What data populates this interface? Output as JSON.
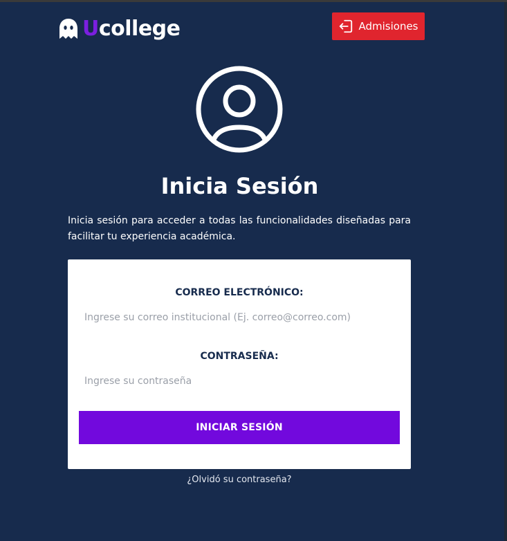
{
  "header": {
    "logo_u": "U",
    "logo_rest": "college",
    "admissions_label": "Admisiones",
    "admissions_icon": "login-arrow-icon"
  },
  "main": {
    "avatar_icon": "user-circle-icon",
    "title": "Inicia Sesión",
    "intro": "Inicia sesión para acceder a todas las funcionalidades diseñadas para facilitar tu experiencia académica."
  },
  "form": {
    "email_label": "CORREO ELECTRÓNICO:",
    "email_value": "",
    "email_placeholder": "Ingrese su correo institucional (Ej. correo@correo.com)",
    "password_label": "CONTRASEÑA:",
    "password_value": "",
    "password_placeholder": "Ingrese su contraseña",
    "submit_label": "INICIAR SESIÓN",
    "forgot_label": "¿Olvidó su contraseña?"
  },
  "colors": {
    "background": "#172b4d",
    "brand_purple": "#7209dd",
    "admissions_red": "#e0252e",
    "card": "#ffffff"
  }
}
